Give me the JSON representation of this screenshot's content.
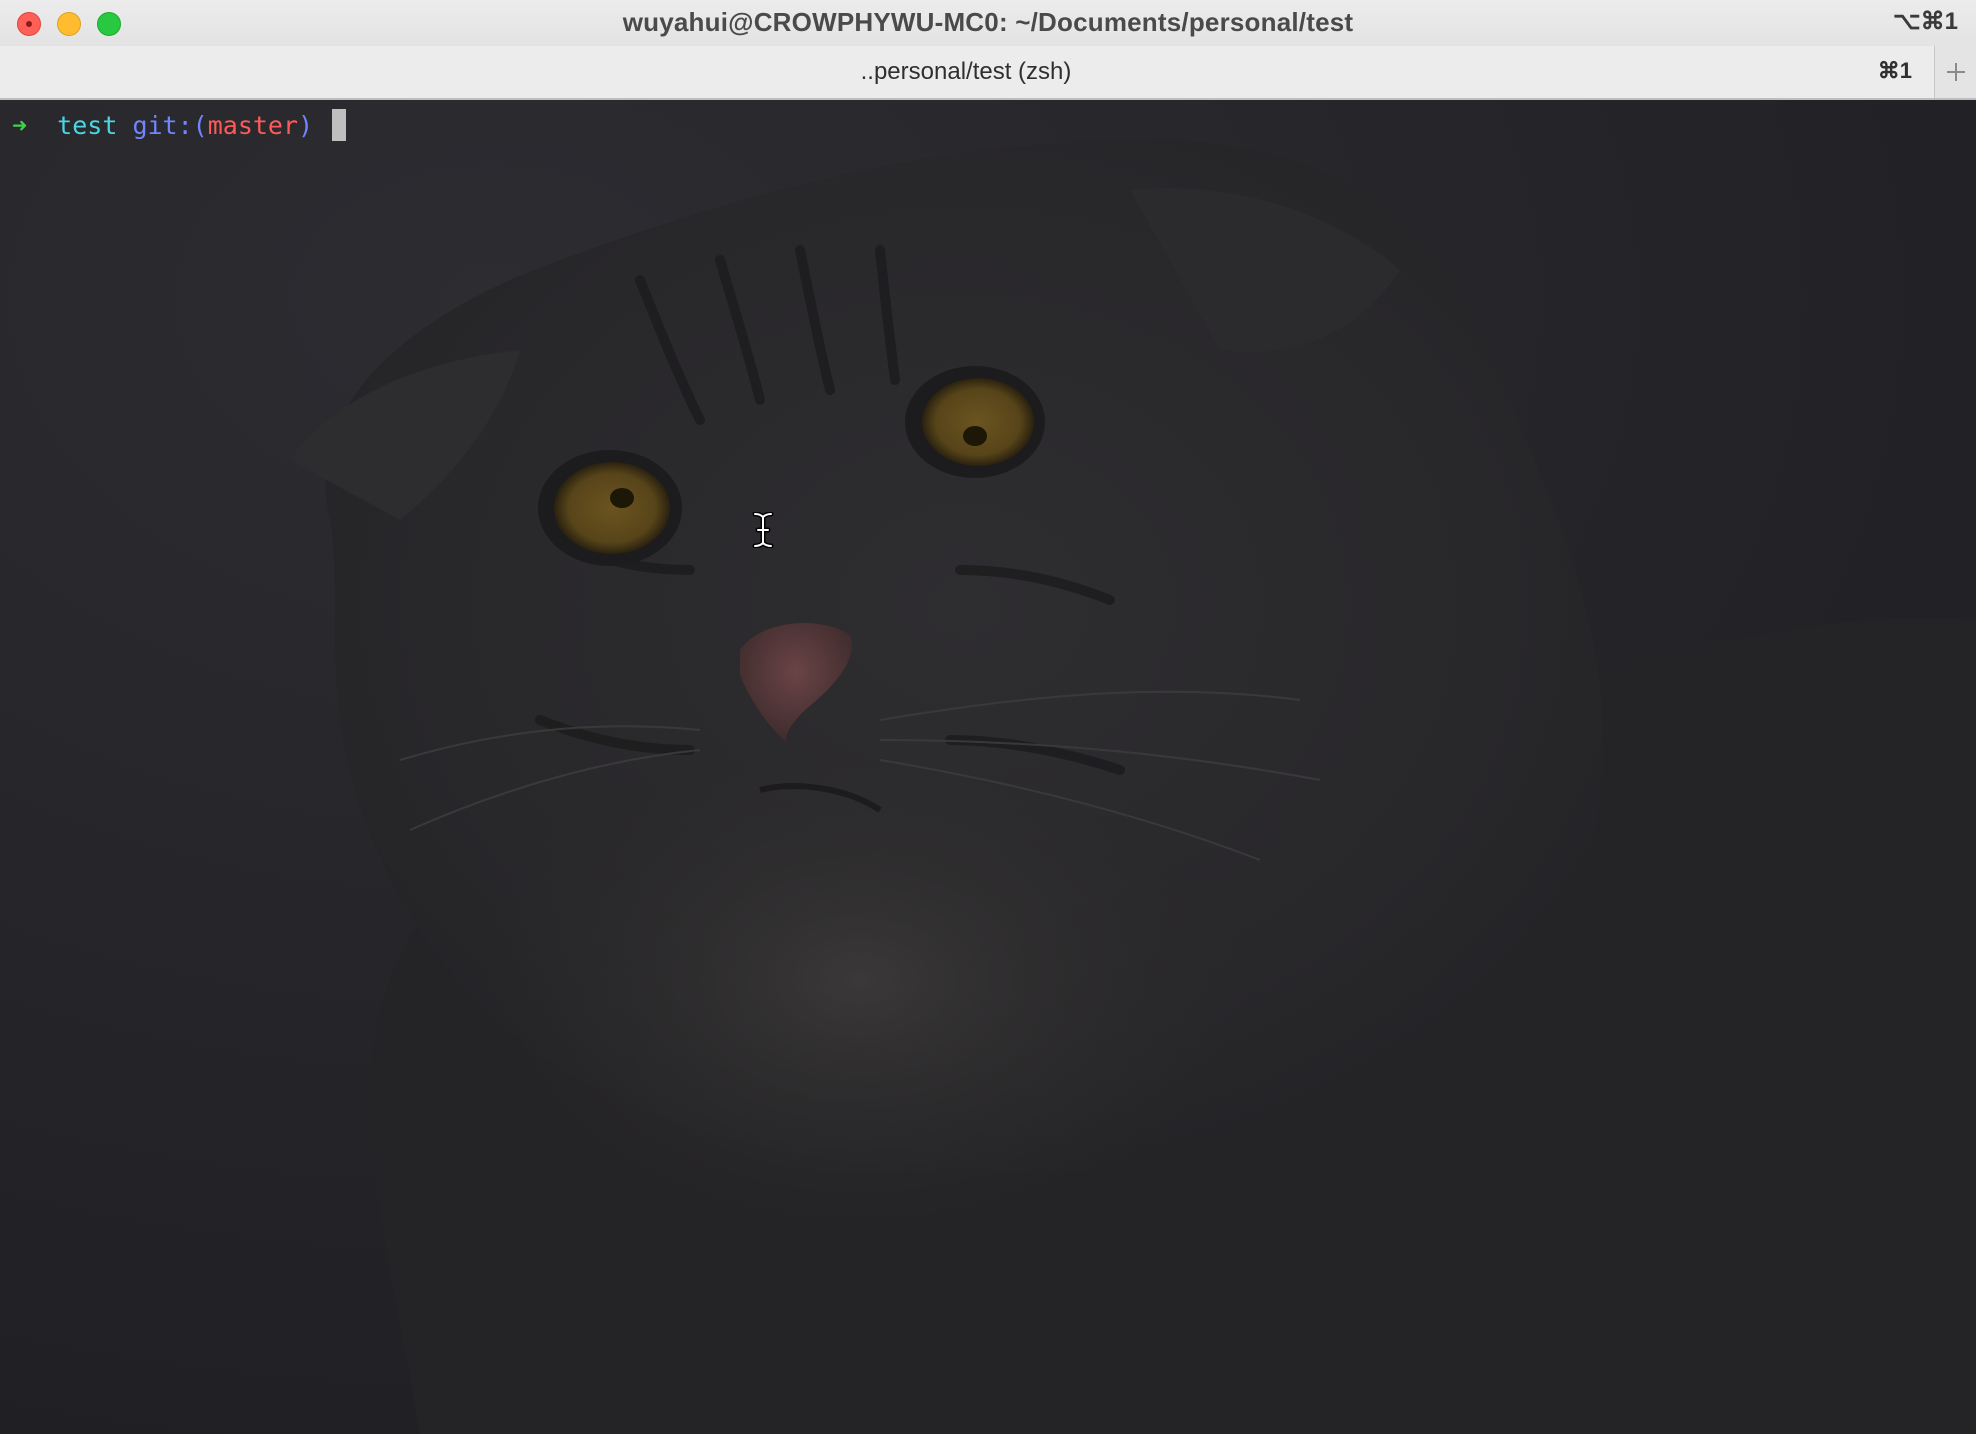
{
  "window": {
    "title": "wuyahui@CROWPHYWU-MC0: ~/Documents/personal/test",
    "shortcut": "⌥⌘1"
  },
  "tabs": [
    {
      "label": "..personal/test (zsh)",
      "shortcut": "⌘1",
      "active": true
    }
  ],
  "new_tab_icon": "plus-icon",
  "terminal": {
    "prompt": {
      "arrow": "➜",
      "directory": "test",
      "git_prefix": "git:(",
      "branch": "master",
      "git_suffix": ")"
    },
    "background_image": "pallas-cat-photo",
    "colors": {
      "arrow": "#3fd14a",
      "directory": "#4cd6e0",
      "git": "#6f86ff",
      "branch": "#ff5a5a"
    }
  },
  "icons": {
    "close": "close-button",
    "minimize": "minimize-button",
    "zoom": "zoom-button",
    "mouse_pointer": "ibeam-cursor-icon"
  }
}
